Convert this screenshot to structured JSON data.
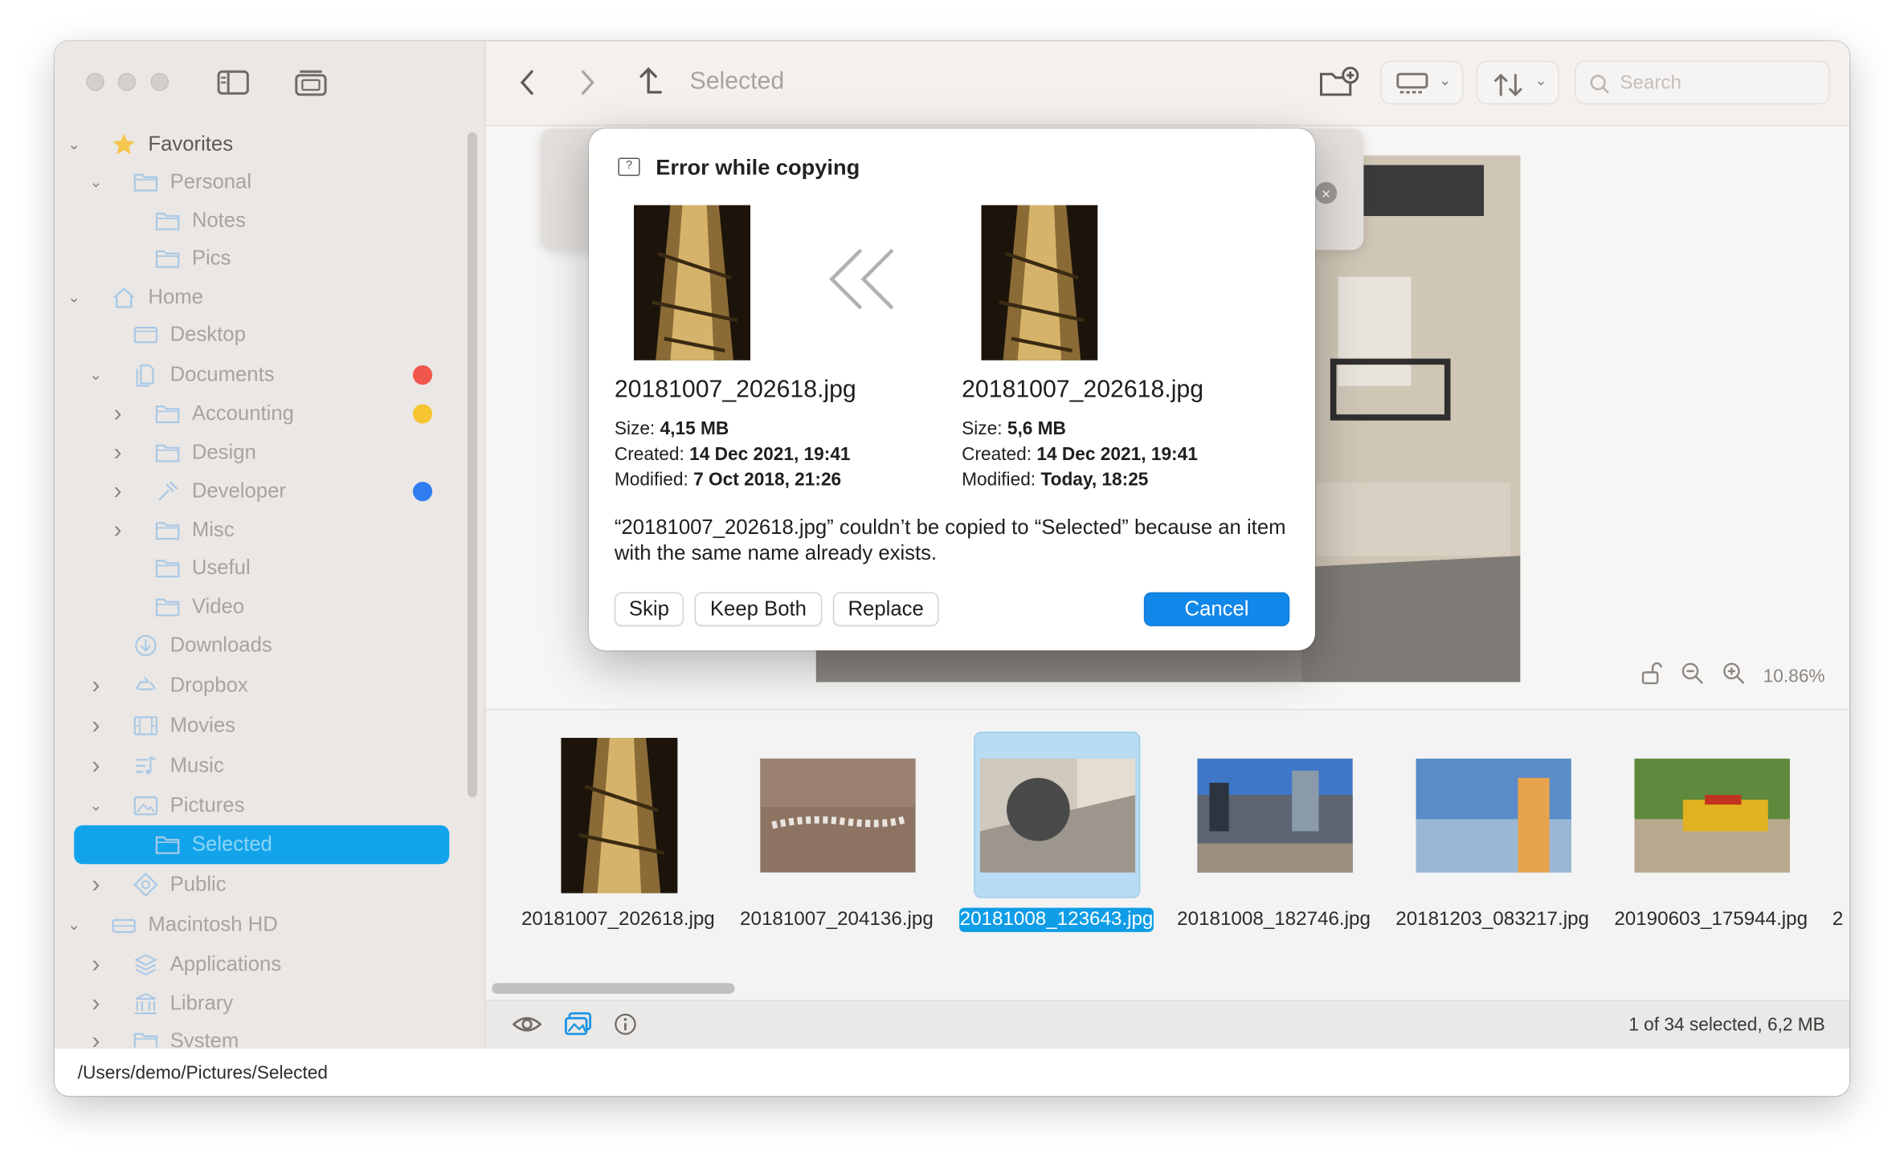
{
  "toolbar": {
    "title": "Selected",
    "search_placeholder": "Search"
  },
  "sidebar": {
    "items": [
      {
        "label": "Favorites",
        "icon": "star-icon",
        "chevron": "down"
      },
      {
        "label": "Personal",
        "icon": "folder-icon",
        "chevron": "down"
      },
      {
        "label": "Notes",
        "icon": "folder-icon",
        "chevron": ""
      },
      {
        "label": "Pics",
        "icon": "folder-icon",
        "chevron": ""
      },
      {
        "label": "Home",
        "icon": "home-icon",
        "chevron": "down"
      },
      {
        "label": "Desktop",
        "icon": "desktop-icon",
        "chevron": ""
      },
      {
        "label": "Documents",
        "icon": "document-icon",
        "chevron": "down",
        "tag": "#f0564b"
      },
      {
        "label": "Accounting",
        "icon": "folder-icon",
        "chevron": "right",
        "tag": "#f7c531"
      },
      {
        "label": "Design",
        "icon": "folder-icon",
        "chevron": "right"
      },
      {
        "label": "Developer",
        "icon": "hammer-icon",
        "chevron": "right",
        "tag": "#2f7df0"
      },
      {
        "label": "Misc",
        "icon": "folder-icon",
        "chevron": "right"
      },
      {
        "label": "Useful",
        "icon": "folder-icon",
        "chevron": ""
      },
      {
        "label": "Video",
        "icon": "folder-icon",
        "chevron": ""
      },
      {
        "label": "Downloads",
        "icon": "download-icon",
        "chevron": ""
      },
      {
        "label": "Dropbox",
        "icon": "dropbox-icon",
        "chevron": "right"
      },
      {
        "label": "Movies",
        "icon": "film-icon",
        "chevron": "right"
      },
      {
        "label": "Music",
        "icon": "music-icon",
        "chevron": "right"
      },
      {
        "label": "Pictures",
        "icon": "photo-icon",
        "chevron": "down"
      },
      {
        "label": "Selected",
        "icon": "folder-icon",
        "chevron": "",
        "selected": true
      },
      {
        "label": "Public",
        "icon": "public-icon",
        "chevron": "right"
      },
      {
        "label": "Macintosh HD",
        "icon": "drive-icon",
        "chevron": "down"
      },
      {
        "label": "Applications",
        "icon": "apps-icon",
        "chevron": "right"
      },
      {
        "label": "Library",
        "icon": "library-icon",
        "chevron": "right"
      },
      {
        "label": "System",
        "icon": "folder-icon",
        "chevron": "right"
      }
    ]
  },
  "preview": {
    "zoom": "10.86%"
  },
  "dialog": {
    "title": "Error while copying",
    "source": {
      "name": "20181007_202618.jpg",
      "size_label": "Size:",
      "size": "4,15 MB",
      "created_label": "Created:",
      "created": "14 Dec 2021, 19:41",
      "modified_label": "Modified:",
      "modified": "7 Oct 2018, 21:26"
    },
    "target": {
      "name": "20181007_202618.jpg",
      "size_label": "Size:",
      "size": "5,6 MB",
      "created_label": "Created:",
      "created": "14 Dec 2021, 19:41",
      "modified_label": "Modified:",
      "modified": "Today, 18:25"
    },
    "message": "“20181007_202618.jpg” couldn’t be copied to “Selected” because an item with the same name already exists.",
    "buttons": {
      "skip": "Skip",
      "keep_both": "Keep Both",
      "replace": "Replace",
      "cancel": "Cancel"
    }
  },
  "filmstrip": {
    "items": [
      {
        "name": "20181007_202618.jpg",
        "kind": "tower"
      },
      {
        "name": "20181007_204136.jpg",
        "kind": "ground"
      },
      {
        "name": "20181008_123643.jpg",
        "kind": "boulder",
        "selected": true
      },
      {
        "name": "20181008_182746.jpg",
        "kind": "city"
      },
      {
        "name": "20181203_083217.jpg",
        "kind": "fog"
      },
      {
        "name": "20190603_175944.jpg",
        "kind": "tram"
      },
      {
        "name": "2",
        "kind": "partial"
      }
    ]
  },
  "status": {
    "selection": "1 of 34 selected, 6,2 MB"
  },
  "path": "/Users/demo/Pictures/Selected"
}
